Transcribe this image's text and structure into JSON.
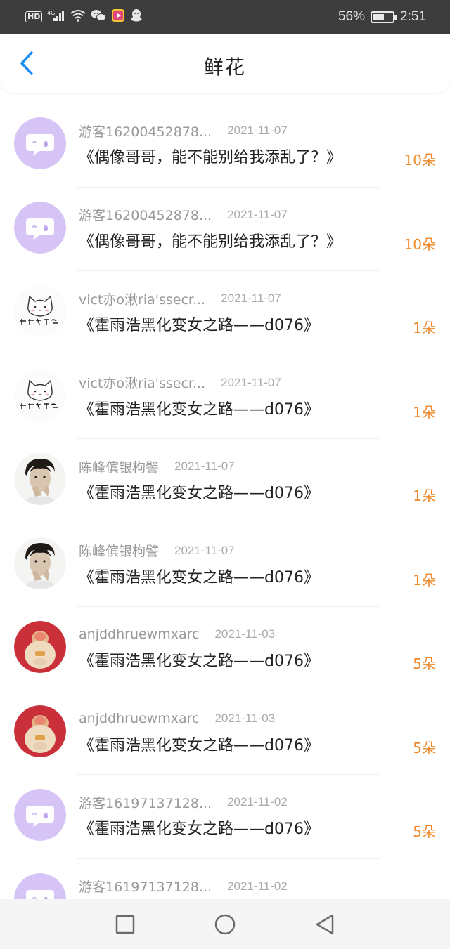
{
  "status_bar": {
    "hd_label": "HD",
    "network_label": "4G",
    "battery_percent": "56%",
    "battery_level": 0.56,
    "time": "2:51",
    "icons": [
      "hd-icon",
      "signal-icon",
      "wifi-icon",
      "wechat-icon",
      "video-app-icon",
      "qq-icon",
      "battery-icon"
    ]
  },
  "header": {
    "back_icon": "chevron-left-icon",
    "title": "鲜花"
  },
  "colors": {
    "accent": "#1e8ef0",
    "amount": "#f0892a",
    "default_avatar": "#d5c4f5"
  },
  "records": [
    {
      "username": "游客16200452878...",
      "date": "2021-11-07",
      "title": "《偶像哥哥，能不能别给我添乱了？》",
      "amount": "10朵",
      "avatar": "default-chat-avatar"
    },
    {
      "username": "游客16200452878...",
      "date": "2021-11-07",
      "title": "《偶像哥哥，能不能别给我添乱了？》",
      "amount": "10朵",
      "avatar": "default-chat-avatar"
    },
    {
      "username": "vict亦o湫ria'ssecr...",
      "date": "2021-11-07",
      "title": "《霍雨浩黑化变女之路——d076》",
      "amount": "1朵",
      "avatar": "cat-sketch-avatar"
    },
    {
      "username": "vict亦o湫ria'ssecr...",
      "date": "2021-11-07",
      "title": "《霍雨浩黑化变女之路——d076》",
      "amount": "1朵",
      "avatar": "cat-sketch-avatar"
    },
    {
      "username": "陈峰傧银枸譬",
      "date": "2021-11-07",
      "title": "《霍雨浩黑化变女之路——d076》",
      "amount": "1朵",
      "avatar": "portrait-avatar"
    },
    {
      "username": "陈峰傧银枸譬",
      "date": "2021-11-07",
      "title": "《霍雨浩黑化变女之路——d076》",
      "amount": "1朵",
      "avatar": "portrait-avatar"
    },
    {
      "username": "anjddhruewmxarc",
      "date": "2021-11-03",
      "title": "《霍雨浩黑化变女之路——d076》",
      "amount": "5朵",
      "avatar": "figurine-avatar"
    },
    {
      "username": "anjddhruewmxarc",
      "date": "2021-11-03",
      "title": "《霍雨浩黑化变女之路——d076》",
      "amount": "5朵",
      "avatar": "figurine-avatar"
    },
    {
      "username": "游客16197137128...",
      "date": "2021-11-02",
      "title": "《霍雨浩黑化变女之路——d076》",
      "amount": "5朵",
      "avatar": "default-chat-avatar"
    },
    {
      "username": "游客16197137128...",
      "date": "2021-11-02",
      "title": "",
      "amount": "",
      "avatar": "default-chat-avatar"
    }
  ],
  "nav_bar": {
    "icons": [
      "recent-apps-icon",
      "home-icon",
      "back-icon"
    ]
  }
}
